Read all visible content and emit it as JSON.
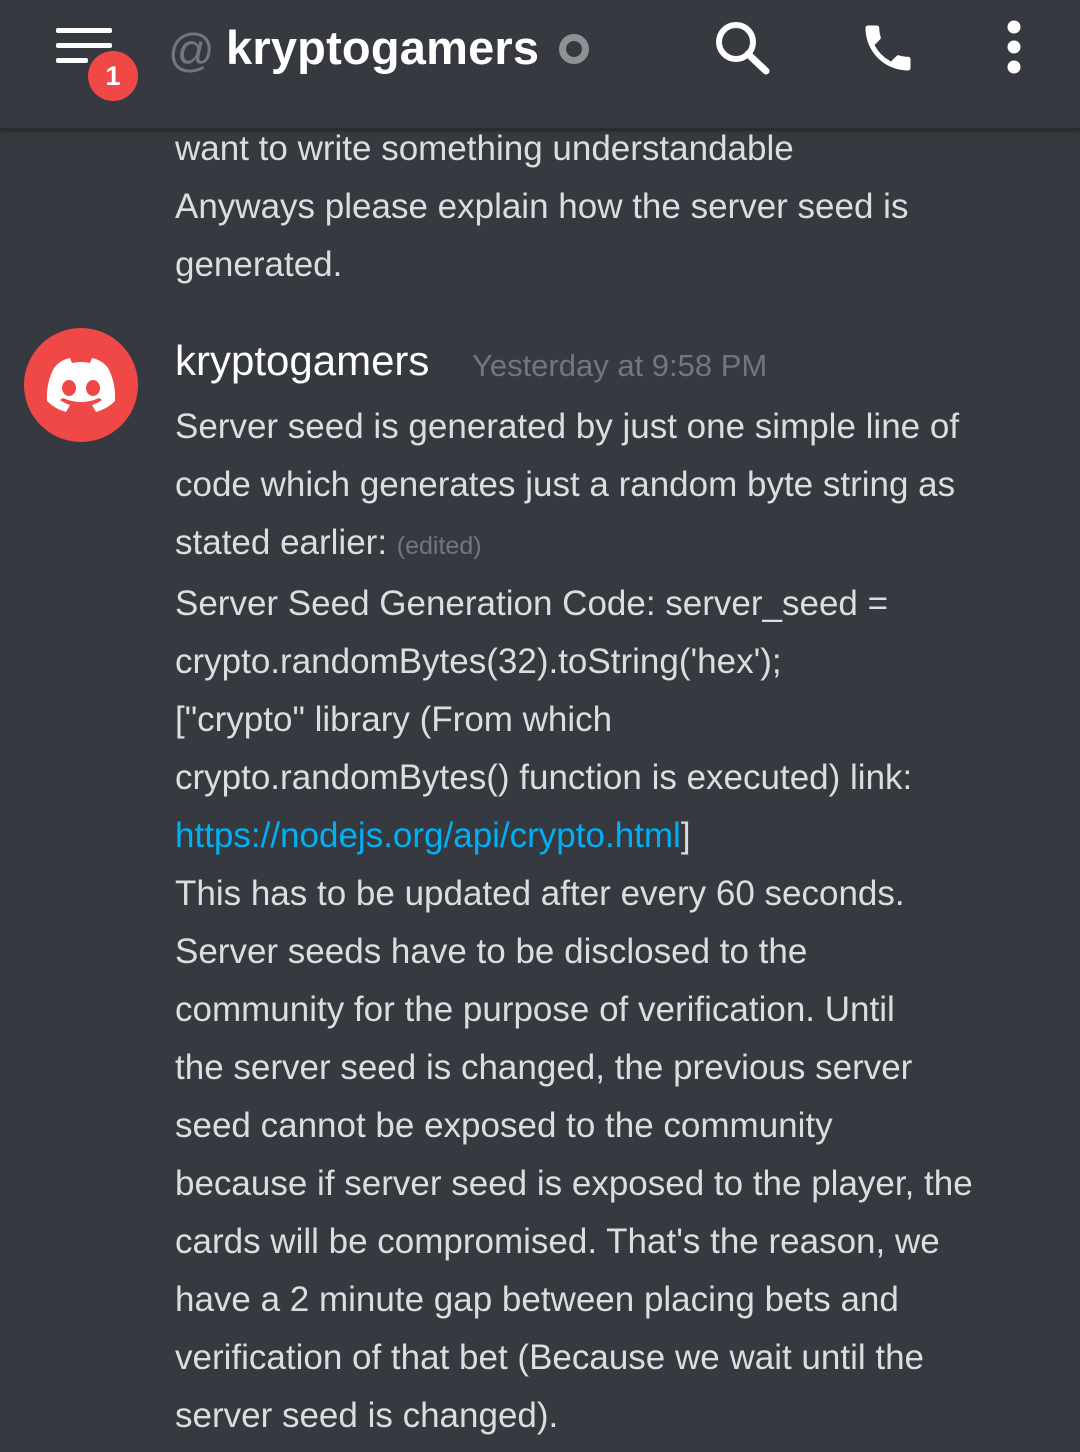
{
  "header": {
    "notification_count": "1",
    "at_symbol": "@",
    "channel_name": "kryptogamers",
    "icons": {
      "menu": "hamburger-menu-icon",
      "search": "search-icon",
      "call": "phone-icon",
      "more": "more-vertical-icon",
      "status": "offline-status-icon"
    }
  },
  "previous_message": {
    "lines": [
      "want to write something understandable",
      "Anyways please explain how the server seed is",
      "generated."
    ]
  },
  "message": {
    "author": "kryptogamers",
    "timestamp": "Yesterday at 9:58 PM",
    "lines": {
      "l1": "Server seed is generated by just one simple line of",
      "l2": "code which generates just a random byte string as",
      "l3": "stated earlier:",
      "edited": "(edited)",
      "l4": "Server Seed Generation Code: server_seed =",
      "l5": "crypto.randomBytes(32).toString('hex');",
      "l6": "[\"crypto\" library (From which",
      "l7": "crypto.randomBytes() function is executed) link:",
      "link": "https://nodejs.org/api/crypto.html",
      "link_suffix": "]",
      "l8": "This has to be updated after every 60 seconds.",
      "l9": "Server seeds have to be disclosed to the",
      "l10": "community for the purpose of verification. Until",
      "l11": "the server seed is changed, the previous server",
      "l12": "seed cannot be exposed to the community",
      "l13": "because if server seed is exposed to the player, the",
      "l14": "cards will be compromised. That's the reason, we",
      "l15": "have a 2 minute gap between placing bets and",
      "l16": "verification of that bet (Because we wait until the",
      "l17": "server seed is changed)."
    }
  },
  "colors": {
    "background": "#36393f",
    "badge": "#f04747",
    "avatar": "#f04747",
    "link": "#00b0f4",
    "muted": "#72767d",
    "text": "#dcddde"
  }
}
